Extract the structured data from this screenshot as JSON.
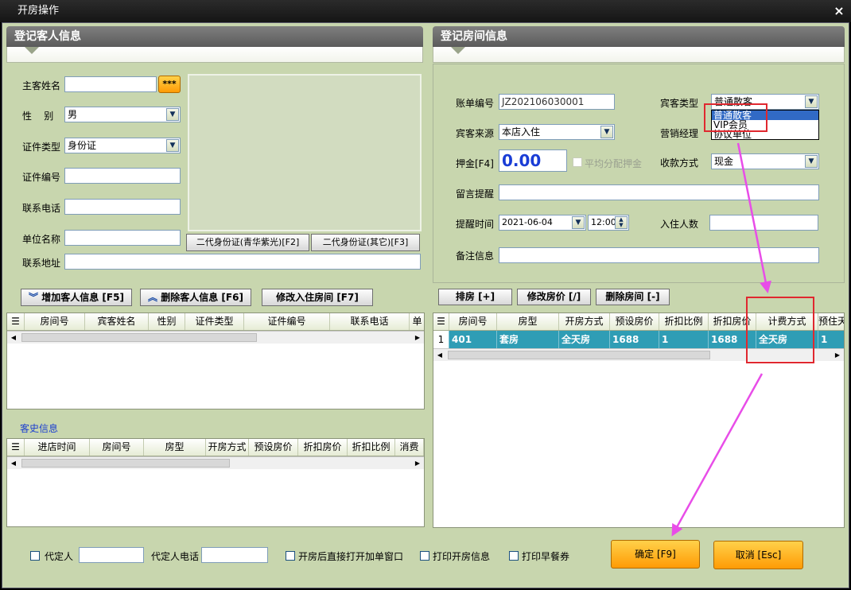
{
  "window": {
    "title": "开房操作",
    "close_label": "×"
  },
  "guest_section": {
    "title": "登记客人信息",
    "name_label": "主客姓名",
    "name_value": "",
    "name_btn": "***",
    "gender_label": "性    别",
    "gender_value": "男",
    "idtype_label": "证件类型",
    "idtype_value": "身份证",
    "idno_label": "证件编号",
    "idno_value": "",
    "phone_label": "联系电话",
    "phone_value": "",
    "company_label": "单位名称",
    "company_value": "",
    "address_label": "联系地址",
    "address_value": "",
    "id_btn1": "二代身份证(青华紫光)[F2]",
    "id_btn2": "二代身份证(其它)[F3]"
  },
  "guest_buttons": {
    "add": "增加客人信息 [F5]",
    "delete": "删除客人信息 [F6]",
    "modify": "修改入住房间 [F7]"
  },
  "guest_grid": {
    "columns": [
      "房间号",
      "宾客姓名",
      "性别",
      "证件类型",
      "证件编号",
      "联系电话",
      "单"
    ]
  },
  "history": {
    "title": "客史信息",
    "columns": [
      "进店时间",
      "房间号",
      "房型",
      "开房方式",
      "预设房价",
      "折扣房价",
      "折扣比例",
      "消费"
    ]
  },
  "room_section": {
    "title": "登记房间信息",
    "bill_label": "账单编号",
    "bill_value": "JZ202106030001",
    "guesttype_label": "宾客类型",
    "guesttype_value": "普通散客",
    "guesttype_options": [
      "普通散客",
      "VIP会员",
      "协议单位"
    ],
    "source_label": "宾客来源",
    "source_value": "本店入住",
    "manager_label": "营销经理",
    "deposit_label": "押金[F4]",
    "deposit_value": "0.00",
    "avg_deposit_label": "平均分配押金",
    "payment_label": "收款方式",
    "payment_value": "现金",
    "message_label": "留言提醒",
    "message_value": "",
    "remind_label": "提醒时间",
    "remind_date": "2021-06-04",
    "remind_time": "12:00",
    "occupants_label": "入住人数",
    "occupants_value": "",
    "notes_label": "备注信息",
    "notes_value": ""
  },
  "room_buttons": {
    "assign": "排房 [+]",
    "modify_price": "修改房价 [/]",
    "delete_room": "删除房间 [-]"
  },
  "room_grid": {
    "columns": [
      "房间号",
      "房型",
      "开房方式",
      "预设房价",
      "折扣比例",
      "折扣房价",
      "计费方式",
      "预住天"
    ],
    "rows": [
      {
        "index": "1",
        "cells": [
          "401",
          "套房",
          "全天房",
          "1688",
          "1",
          "1688",
          "全天房",
          "1"
        ]
      }
    ]
  },
  "footer": {
    "proxy_label": "代定人",
    "proxy_value": "",
    "proxy_phone_label": "代定人电话",
    "proxy_phone_value": "",
    "open_bill_label": "开房后直接打开加单窗口",
    "print_info_label": "打印开房信息",
    "print_breakfast_label": "打印早餐券",
    "confirm_label": "确定 [F9]",
    "cancel_label": "取消 [Esc]"
  },
  "colors": {
    "panel_bg": "#c8d6ae",
    "selection_row": "#2f9db5",
    "annotation_red": "#e0282f",
    "annotation_arrow": "#e84de8",
    "orange_button": "#ffb020"
  }
}
